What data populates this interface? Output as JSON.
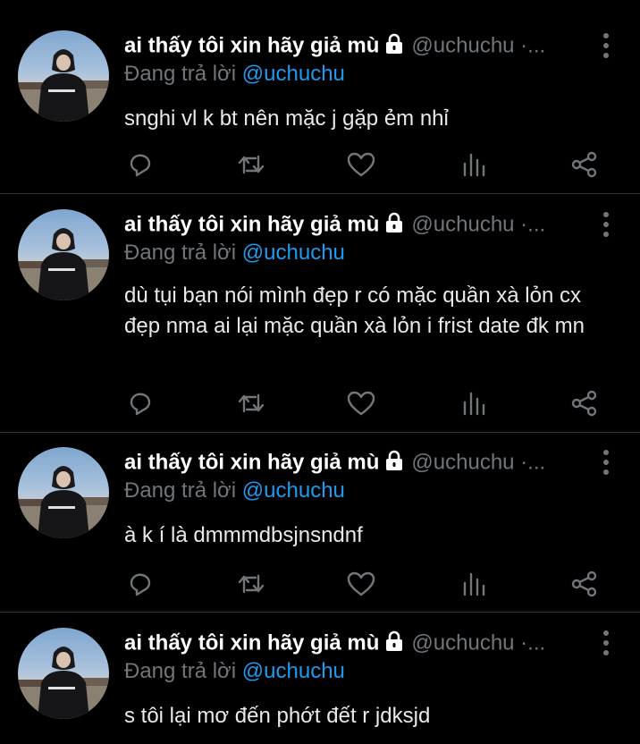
{
  "tweets": [
    {
      "display_name": "ai thấy tôi xin hãy giả mù",
      "handle": "@uchuchu ·...",
      "reply_prefix": "Đang trả lời",
      "reply_to": "@uchuchu",
      "text": "snghi vl k bt nên mặc j gặp ẻm nhỉ"
    },
    {
      "display_name": "ai thấy tôi xin hãy giả mù",
      "handle": "@uchuchu ·...",
      "reply_prefix": "Đang trả lời",
      "reply_to": "@uchuchu",
      "text": "dù tụi bạn nói mình đẹp r có mặc quần xà lỏn cx đẹp nma ai lại mặc quần xà lỏn i frist date đk mn"
    },
    {
      "display_name": "ai thấy tôi xin hãy giả mù",
      "handle": "@uchuchu ·...",
      "reply_prefix": "Đang trả lời",
      "reply_to": "@uchuchu",
      "text": "à k í là dmmmdbsjnsndnf"
    },
    {
      "display_name": "ai thấy tôi xin hãy giả mù",
      "handle": "@uchuchu ·...",
      "reply_prefix": "Đang trả lời",
      "reply_to": "@uchuchu",
      "text": "s tôi lại mơ đến phớt đết r jdksjd"
    }
  ],
  "icons": {
    "lock": "lock-icon",
    "more": "more-vertical-icon",
    "reply": "reply-icon",
    "retweet": "retweet-icon",
    "like": "like-icon",
    "views": "views-icon",
    "share": "share-icon"
  },
  "colors": {
    "background": "#000000",
    "text": "#e7e9ea",
    "secondary": "#71767b",
    "mention": "#1d9bf0",
    "divider": "#2f3336"
  }
}
